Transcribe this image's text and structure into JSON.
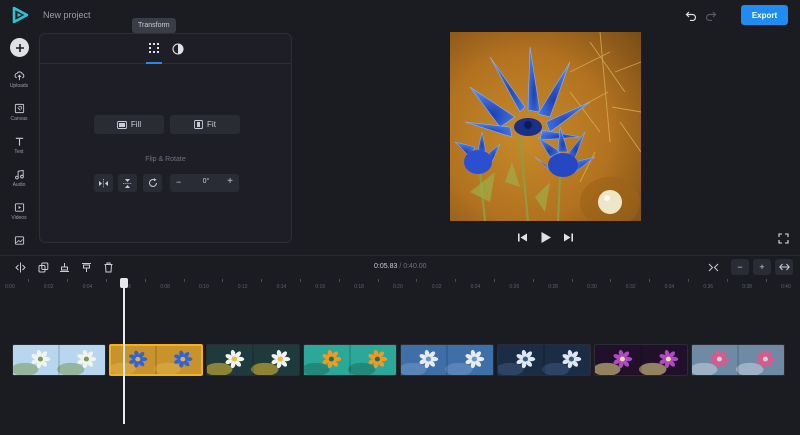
{
  "header": {
    "project_title": "New project",
    "export_label": "Export"
  },
  "colors": {
    "accent": "#1e8cf0",
    "selected_clip": "#f2b318",
    "background": "#1b1c22"
  },
  "sidebar": {
    "items": [
      {
        "label": "Uploads",
        "icon": "upload-icon"
      },
      {
        "label": "Canvas",
        "icon": "canvas-icon"
      },
      {
        "label": "Text",
        "icon": "text-icon"
      },
      {
        "label": "Audio",
        "icon": "music-icon"
      },
      {
        "label": "Videos",
        "icon": "video-icon"
      },
      {
        "label": "",
        "icon": "image-icon"
      }
    ]
  },
  "panel": {
    "tooltip": "Transform",
    "tabs": [
      {
        "icon": "transform-icon",
        "active": true
      },
      {
        "icon": "filter-icon",
        "active": false
      }
    ],
    "fill_label": "Fill",
    "fit_label": "Fit",
    "flip_rotate_label": "Flip & Rotate",
    "rotation_value": "0°"
  },
  "timeline": {
    "current_time": "0:05.83",
    "separator": "/",
    "total_time": "0:40.00",
    "ruler_labels": [
      "0:00",
      "0:02",
      "0:04",
      "0:06",
      "0:08",
      "0:10",
      "0:12",
      "0:14",
      "0:16",
      "0:18",
      "0:20",
      "0:22",
      "0:24",
      "0:26",
      "0:28",
      "0:30",
      "0:32",
      "0:34",
      "0:36",
      "0:38",
      "0:40"
    ],
    "clips": [
      {
        "name": "white-blossoms",
        "selected": false,
        "colors": [
          "#b8d6f0",
          "#f3f3ee",
          "#7a9a5a"
        ]
      },
      {
        "name": "blue-flowers",
        "selected": true,
        "colors": [
          "#c8922c",
          "#2f63d8",
          "#e0b04a"
        ]
      },
      {
        "name": "daisy",
        "selected": false,
        "colors": [
          "#1f3a3d",
          "#f2f2f0",
          "#e8c030"
        ]
      },
      {
        "name": "orange-flower",
        "selected": false,
        "colors": [
          "#2aa89a",
          "#f29a20",
          "#1d6e65"
        ]
      },
      {
        "name": "dandelion",
        "selected": false,
        "colors": [
          "#3f6fa8",
          "#e8ecef",
          "#6f95c4"
        ]
      },
      {
        "name": "white-lily",
        "selected": false,
        "colors": [
          "#1b2c45",
          "#dfe8f2",
          "#3c5a80"
        ]
      },
      {
        "name": "purple-flower",
        "selected": false,
        "colors": [
          "#20102a",
          "#b048c8",
          "#f0e08a"
        ]
      },
      {
        "name": "pink-rose",
        "selected": false,
        "colors": [
          "#6f8aa4",
          "#d85a8a",
          "#c7d4e0"
        ]
      }
    ]
  }
}
